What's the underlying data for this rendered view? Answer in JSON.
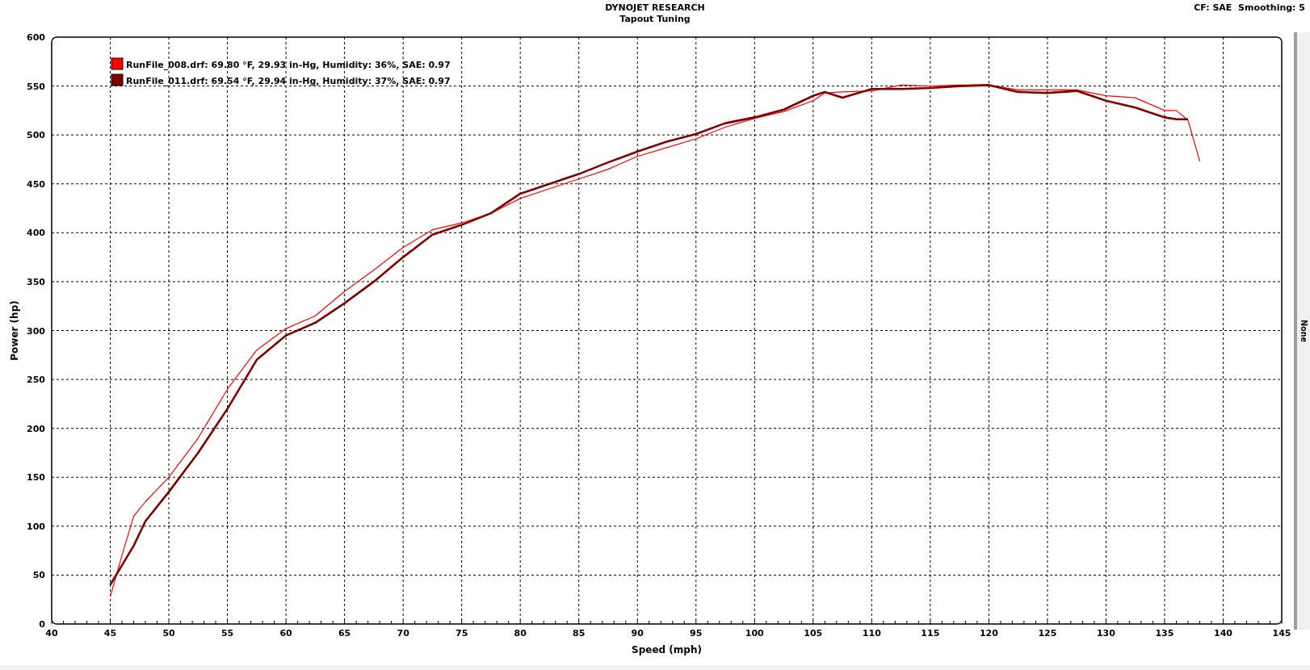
{
  "header": {
    "title": "DYNOJET RESEARCH",
    "subtitle": "Tapout Tuning",
    "settings": "CF: SAE  Smoothing: 5"
  },
  "right_axis_label": "None",
  "chart_data": {
    "type": "line",
    "grid": true,
    "legend": true,
    "xlabel": "Speed (mph)",
    "ylabel": "Power (hp)",
    "xlim": [
      40,
      145
    ],
    "ylim": [
      0,
      600
    ],
    "xticks": [
      40,
      45,
      50,
      55,
      60,
      65,
      70,
      75,
      80,
      85,
      90,
      95,
      100,
      105,
      110,
      115,
      120,
      125,
      130,
      135,
      140,
      145
    ],
    "yticks": [
      0,
      50,
      100,
      150,
      200,
      250,
      300,
      350,
      400,
      450,
      500,
      550,
      600
    ],
    "x": [
      45,
      46,
      47,
      48,
      50,
      52.5,
      55,
      57.5,
      60,
      62.5,
      65,
      67.5,
      70,
      72.5,
      75,
      77.5,
      80,
      82.5,
      85,
      87.5,
      90,
      92.5,
      95,
      97.5,
      100,
      102.5,
      105,
      106,
      107.5,
      110,
      112.5,
      115,
      117.5,
      120,
      122.5,
      125,
      127.5,
      130,
      132.5,
      135,
      136,
      137,
      138
    ],
    "series": [
      {
        "name": "RunFile_008.drf: 69.80 °F, 29.93 in-Hg, Humidity: 36%, SAE: 0.97",
        "color": "#ff0000",
        "values": [
          28,
          70,
          110,
          125,
          150,
          190,
          240,
          280,
          302,
          315,
          340,
          362,
          385,
          403,
          410,
          420,
          435,
          445,
          455,
          465,
          478,
          487,
          496,
          508,
          517,
          524,
          535,
          543,
          544,
          545,
          551,
          550,
          551,
          551,
          546,
          546,
          546,
          540,
          538,
          525,
          525,
          515,
          473
        ]
      },
      {
        "name": "RunFile_011.drf: 69.54 °F, 29.94 in-Hg, Humidity: 37%, SAE: 0.97",
        "color": "#800000",
        "values": [
          40,
          60,
          80,
          105,
          135,
          175,
          220,
          270,
          295,
          308,
          328,
          350,
          375,
          398,
          408,
          420,
          440,
          450,
          460,
          472,
          483,
          493,
          501,
          512,
          518,
          526,
          540,
          544,
          538,
          547,
          547,
          548,
          550,
          551,
          544,
          543,
          545,
          535,
          528,
          518,
          516,
          516,
          null
        ]
      }
    ]
  }
}
